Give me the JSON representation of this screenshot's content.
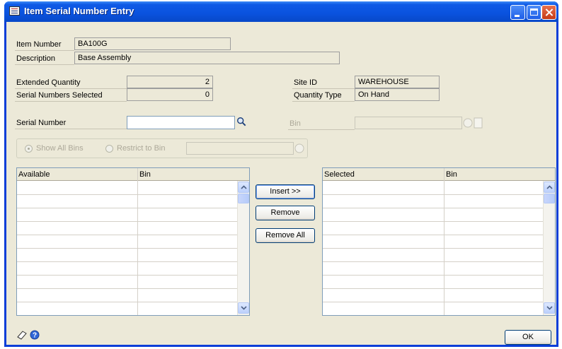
{
  "window": {
    "title": "Item Serial Number Entry"
  },
  "item": {
    "number_label": "Item Number",
    "number_value": "BA100G",
    "description_label": "Description",
    "description_value": "Base Assembly"
  },
  "quantities": {
    "extended_label": "Extended Quantity",
    "extended_value": "2",
    "selected_label": "Serial Numbers Selected",
    "selected_value": "0"
  },
  "site": {
    "site_id_label": "Site ID",
    "site_id_value": "WAREHOUSE",
    "quantity_type_label": "Quantity Type",
    "quantity_type_value": "On Hand"
  },
  "serial": {
    "label": "Serial Number",
    "value": ""
  },
  "bin": {
    "label": "Bin",
    "value": ""
  },
  "bin_filter": {
    "show_all_label": "Show All Bins",
    "restrict_label": "Restrict to Bin",
    "selected": "show_all",
    "restrict_value": ""
  },
  "available_grid": {
    "columns": [
      "Available",
      "Bin"
    ],
    "rows": 9
  },
  "selected_grid": {
    "columns": [
      "Selected",
      "Bin"
    ],
    "rows": 9
  },
  "actions": {
    "insert_label": "Insert >>",
    "remove_label": "Remove",
    "remove_all_label": "Remove All",
    "ok_label": "OK"
  },
  "icons": [
    "app-icon",
    "search-icon",
    "lookup-icon",
    "note-icon",
    "help-icon",
    "scroll-up-icon",
    "scroll-down-icon",
    "minimize-icon",
    "maximize-icon",
    "close-icon"
  ],
  "colors": {
    "titlebar": "#0a52de",
    "dialog_bg": "#ece9d8",
    "accent": "#003c74"
  }
}
